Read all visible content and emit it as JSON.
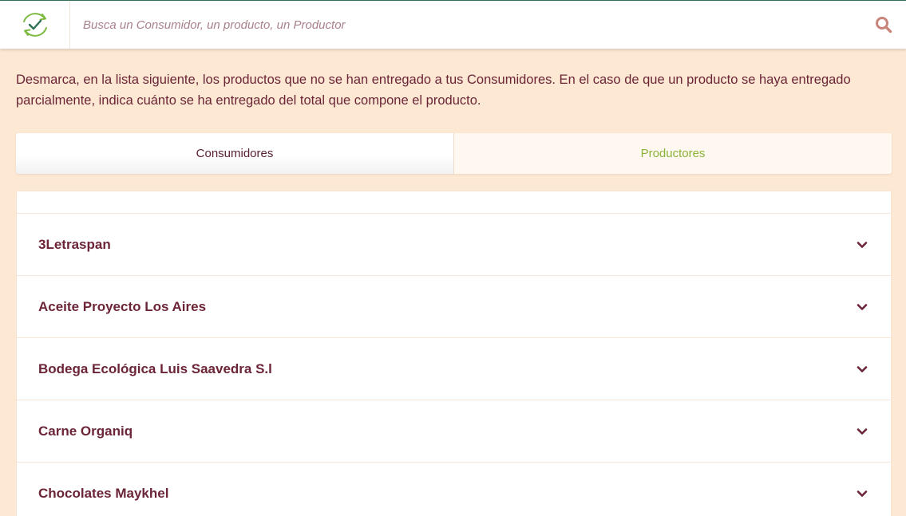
{
  "search": {
    "placeholder": "Busca un Consumidor, un producto, un Productor"
  },
  "intro": {
    "text": "Desmarca, en la lista siguiente, los productos que no se han entregado a tus Consumidores. En el caso de que un producto se haya entregado parcialmente, indica cuánto se ha entregado del total que compone el producto."
  },
  "tabs": [
    {
      "label": "Consumidores",
      "active": true
    },
    {
      "label": "Productores",
      "active": false
    }
  ],
  "producers": [
    {
      "name": "3Letraspan"
    },
    {
      "name": "Aceite Proyecto Los Aires"
    },
    {
      "name": "Bodega Ecológica Luis Saavedra S.l"
    },
    {
      "name": "Carne Organiq"
    },
    {
      "name": "Chocolates Maykhel"
    }
  ],
  "colors": {
    "text": "#6b2537",
    "background": "#fde8d3",
    "accent_green": "#8ab33a",
    "search_icon": "#c9857a",
    "logo_green": "#7cba3f"
  },
  "icons": {
    "logo": "check-cycle-icon",
    "search": "search-icon",
    "row_toggle": "chevron-down-icon"
  }
}
